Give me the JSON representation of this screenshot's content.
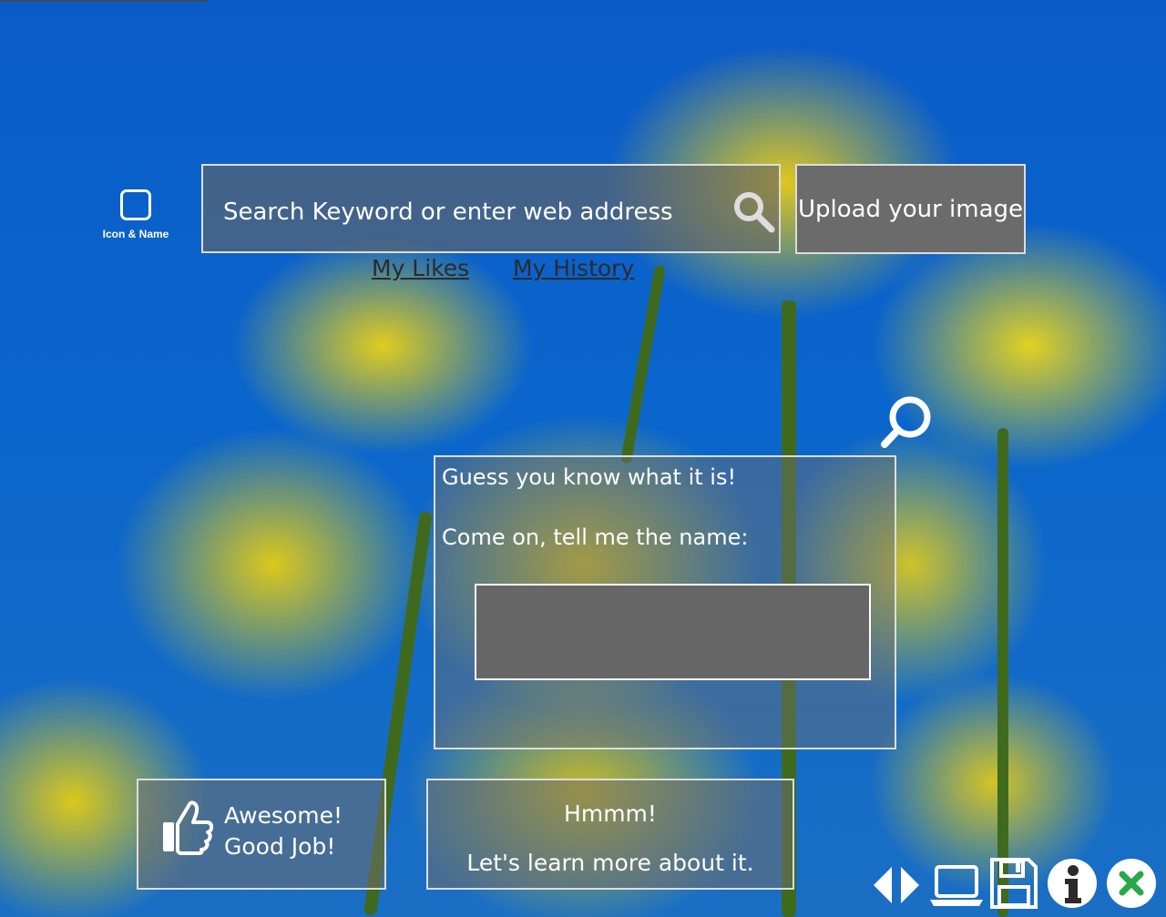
{
  "header": {
    "app_icon_label": "Icon & Name"
  },
  "search": {
    "placeholder": "Search Keyword or enter web address",
    "icon": "search-icon"
  },
  "upload": {
    "label": "Upload your image"
  },
  "links": {
    "likes": "My Likes",
    "history": "My History"
  },
  "quiz": {
    "line1": "Guess you know what it is!",
    "line2": "Come on, tell me the name:",
    "answer_value": ""
  },
  "feedback": {
    "awesome_line1": "Awesome!",
    "awesome_line2": "Good Job!",
    "learn_line1": "Hmmm!",
    "learn_line2": "Let's learn more about it."
  },
  "toolbar": {
    "icons": [
      "prev-next-arrows-icon",
      "laptop-icon",
      "save-icon",
      "info-icon",
      "close-icon"
    ]
  },
  "colors": {
    "sky_blue": "#0a66cc",
    "flower_yellow": "#e8cd18",
    "panel_gray": "#6b6b6b",
    "close_accent": "#2aa84a"
  }
}
